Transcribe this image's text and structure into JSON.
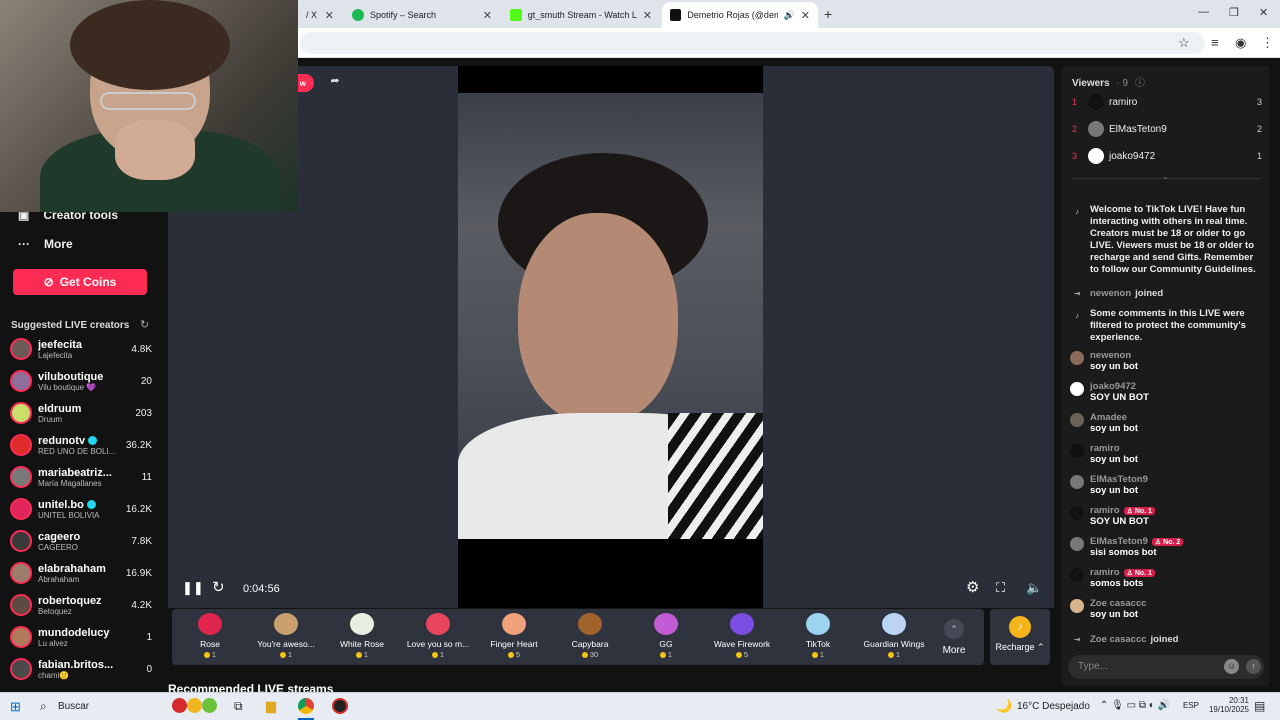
{
  "browser": {
    "tabs": [
      {
        "label": "/ X",
        "close": "✕"
      },
      {
        "label": "Spotify – Search",
        "close": "✕"
      },
      {
        "label": "gt_smuth Stream - Watch Live o",
        "close": "✕"
      },
      {
        "label": "Demetrio Rojas (@demerjs",
        "close": "✕"
      }
    ],
    "new_tab": "+",
    "window": {
      "minimize": "—",
      "restore": "❐",
      "close": "✕"
    }
  },
  "sidebar": {
    "creator_tools": "Creator tools",
    "more": "More",
    "get_coins": "Get Coins",
    "suggested_title": "Suggested LIVE creators",
    "creators": [
      {
        "name": "jeefecita",
        "sub": "Lajefecita",
        "count": "4.8K",
        "color": "#6b5a55"
      },
      {
        "name": "viluboutique",
        "sub": "Vilu boutique 💜",
        "count": "20",
        "color": "#8e6f9c"
      },
      {
        "name": "eldruum",
        "sub": "Druum",
        "count": "203",
        "color": "#c8e06b"
      },
      {
        "name": "redunotv",
        "sub": "RED UNO DE BOLI...",
        "count": "36.2K",
        "color": "#e02b2b",
        "verified": true
      },
      {
        "name": "mariabeatriz...",
        "sub": "María Magallanes",
        "count": "11",
        "color": "#7a7a7a"
      },
      {
        "name": "unitel.bo",
        "sub": "UNITEL BOLIVIA",
        "count": "16.2K",
        "color": "#e0255a",
        "verified": true
      },
      {
        "name": "cageero",
        "sub": "CAGEERO",
        "count": "7.8K",
        "color": "#3a3a3a"
      },
      {
        "name": "elabrahaham",
        "sub": "Abrahaham",
        "count": "16.9K",
        "color": "#9a7d6b"
      },
      {
        "name": "robertoquez",
        "sub": "Betoquez",
        "count": "4.2K",
        "color": "#5d4a42"
      },
      {
        "name": "mundodelucy",
        "sub": "Lu alvez",
        "count": "1",
        "color": "#b07a5c"
      },
      {
        "name": "fabian.britos...",
        "sub": "chami🙂",
        "count": "0",
        "color": "#4a4a4a"
      }
    ]
  },
  "player": {
    "live_label": "w",
    "time": "0:04:56"
  },
  "gifts": [
    {
      "name": "Rose",
      "price": "1",
      "color": "#e0264f"
    },
    {
      "name": "You're aweso...",
      "price": "1",
      "color": "#c9a06d"
    },
    {
      "name": "White Rose",
      "price": "1",
      "color": "#e8efe0"
    },
    {
      "name": "Love you so m...",
      "price": "1",
      "color": "#e8455c"
    },
    {
      "name": "Finger Heart",
      "price": "5",
      "color": "#f0a07a"
    },
    {
      "name": "Capybara",
      "price": "30",
      "color": "#a0632c"
    },
    {
      "name": "GG",
      "price": "1",
      "color": "#c25cd6"
    },
    {
      "name": "Wave Firework",
      "price": "5",
      "color": "#7b4de0"
    },
    {
      "name": "TikTok",
      "price": "1",
      "color": "#9ed4f0"
    },
    {
      "name": "Guardian Wings",
      "price": "1",
      "color": "#bcd4f5"
    }
  ],
  "more_gifts": "More",
  "recharge": "Recharge",
  "recommended_title": "Recommended LIVE streams",
  "chat": {
    "viewers_label": "Viewers",
    "viewers_count": "9",
    "top_viewers": [
      {
        "rank": "1",
        "name": "ramiro",
        "score": "3",
        "color": "#111"
      },
      {
        "rank": "2",
        "name": "ElMasTeton9",
        "score": "2",
        "color": "#777"
      },
      {
        "rank": "3",
        "name": "joako9472",
        "score": "1",
        "color": "#fff"
      }
    ],
    "welcome": "Welcome to TikTok LIVE! Have fun interacting with others in real time. Creators must be 18 or older to go LIVE. Viewers must be 18 or older to recharge and send Gifts. Remember to follow our Community Guidelines.",
    "joined_1": {
      "name": "newenon",
      "action": "joined"
    },
    "filtered": "Some comments in this LIVE were filtered to protect the community's experience.",
    "messages": [
      {
        "name": "newenon",
        "text": "soy un bot",
        "badge": "",
        "color": "#8a6b5a"
      },
      {
        "name": "joako9472",
        "text": "SOY UN BOT",
        "badge": "",
        "color": "#fff"
      },
      {
        "name": "Amadee",
        "text": "soy un bot",
        "badge": "",
        "color": "#6b6258"
      },
      {
        "name": "ramiro",
        "text": "soy un bot",
        "badge": "",
        "color": "#111"
      },
      {
        "name": "ElMasTeton9",
        "text": "soy un bot",
        "badge": "",
        "color": "#777"
      },
      {
        "name": "ramiro",
        "text": "SOY UN BOT",
        "badge": "No. 1",
        "color": "#111"
      },
      {
        "name": "ElMasTeton9",
        "text": "sisi somos bot",
        "badge": "No. 2",
        "color": "#777"
      },
      {
        "name": "ramiro",
        "text": "somos bots",
        "badge": "No. 1",
        "color": "#111"
      },
      {
        "name": "Zoe casaccc",
        "text": "soy un bot",
        "badge": "",
        "color": "#d9b48a"
      }
    ],
    "joined_2": {
      "name": "Zoe casaccc",
      "action": "joined"
    },
    "input_placeholder": "Type..."
  },
  "taskbar": {
    "search": "Buscar",
    "weather": "16°C  Despejado",
    "lang": "ESP",
    "time": "20:31",
    "date": "19/10/2025"
  }
}
